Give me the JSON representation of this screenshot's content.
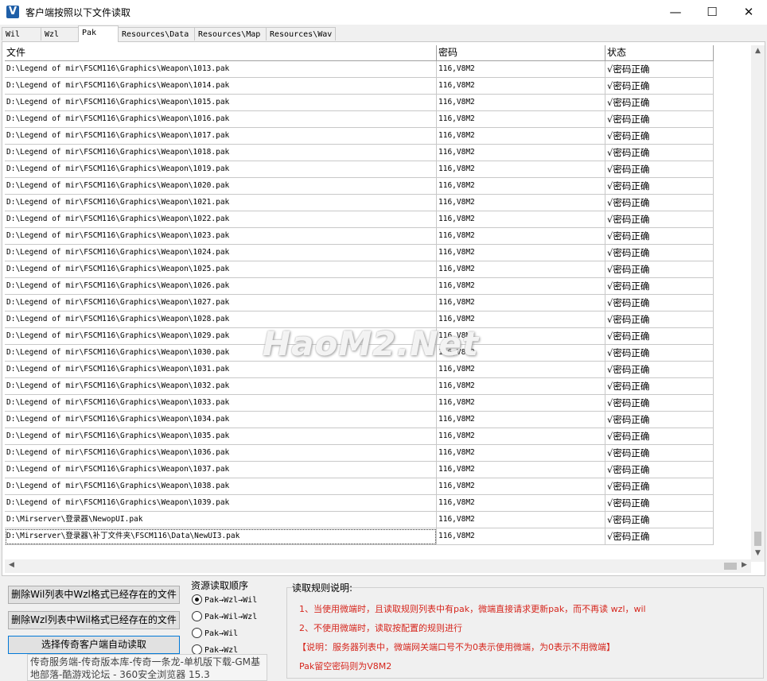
{
  "window": {
    "title": "客户端按照以下文件读取",
    "app_icon": "V",
    "controls": {
      "minimize": "—",
      "maximize": "☐",
      "close": "✕"
    }
  },
  "tabs": [
    {
      "label": "Wil"
    },
    {
      "label": "Wzl"
    },
    {
      "label": "Pak",
      "active": true
    },
    {
      "label": "Resources\\Data"
    },
    {
      "label": "Resources\\Map"
    },
    {
      "label": "Resources\\Wav"
    }
  ],
  "table": {
    "headers": {
      "file": "文件",
      "password": "密码",
      "status": "状态"
    },
    "rows": [
      {
        "file": "D:\\Legend of mir\\FSCM116\\Graphics\\Weapon\\1013.pak",
        "password": "116,V8M2",
        "status": "√密码正确"
      },
      {
        "file": "D:\\Legend of mir\\FSCM116\\Graphics\\Weapon\\1014.pak",
        "password": "116,V8M2",
        "status": "√密码正确"
      },
      {
        "file": "D:\\Legend of mir\\FSCM116\\Graphics\\Weapon\\1015.pak",
        "password": "116,V8M2",
        "status": "√密码正确"
      },
      {
        "file": "D:\\Legend of mir\\FSCM116\\Graphics\\Weapon\\1016.pak",
        "password": "116,V8M2",
        "status": "√密码正确"
      },
      {
        "file": "D:\\Legend of mir\\FSCM116\\Graphics\\Weapon\\1017.pak",
        "password": "116,V8M2",
        "status": "√密码正确"
      },
      {
        "file": "D:\\Legend of mir\\FSCM116\\Graphics\\Weapon\\1018.pak",
        "password": "116,V8M2",
        "status": "√密码正确"
      },
      {
        "file": "D:\\Legend of mir\\FSCM116\\Graphics\\Weapon\\1019.pak",
        "password": "116,V8M2",
        "status": "√密码正确"
      },
      {
        "file": "D:\\Legend of mir\\FSCM116\\Graphics\\Weapon\\1020.pak",
        "password": "116,V8M2",
        "status": "√密码正确"
      },
      {
        "file": "D:\\Legend of mir\\FSCM116\\Graphics\\Weapon\\1021.pak",
        "password": "116,V8M2",
        "status": "√密码正确"
      },
      {
        "file": "D:\\Legend of mir\\FSCM116\\Graphics\\Weapon\\1022.pak",
        "password": "116,V8M2",
        "status": "√密码正确"
      },
      {
        "file": "D:\\Legend of mir\\FSCM116\\Graphics\\Weapon\\1023.pak",
        "password": "116,V8M2",
        "status": "√密码正确"
      },
      {
        "file": "D:\\Legend of mir\\FSCM116\\Graphics\\Weapon\\1024.pak",
        "password": "116,V8M2",
        "status": "√密码正确"
      },
      {
        "file": "D:\\Legend of mir\\FSCM116\\Graphics\\Weapon\\1025.pak",
        "password": "116,V8M2",
        "status": "√密码正确"
      },
      {
        "file": "D:\\Legend of mir\\FSCM116\\Graphics\\Weapon\\1026.pak",
        "password": "116,V8M2",
        "status": "√密码正确"
      },
      {
        "file": "D:\\Legend of mir\\FSCM116\\Graphics\\Weapon\\1027.pak",
        "password": "116,V8M2",
        "status": "√密码正确"
      },
      {
        "file": "D:\\Legend of mir\\FSCM116\\Graphics\\Weapon\\1028.pak",
        "password": "116,V8M2",
        "status": "√密码正确"
      },
      {
        "file": "D:\\Legend of mir\\FSCM116\\Graphics\\Weapon\\1029.pak",
        "password": "116,V8M2",
        "status": "√密码正确"
      },
      {
        "file": "D:\\Legend of mir\\FSCM116\\Graphics\\Weapon\\1030.pak",
        "password": "116,V8M2",
        "status": "√密码正确"
      },
      {
        "file": "D:\\Legend of mir\\FSCM116\\Graphics\\Weapon\\1031.pak",
        "password": "116,V8M2",
        "status": "√密码正确"
      },
      {
        "file": "D:\\Legend of mir\\FSCM116\\Graphics\\Weapon\\1032.pak",
        "password": "116,V8M2",
        "status": "√密码正确"
      },
      {
        "file": "D:\\Legend of mir\\FSCM116\\Graphics\\Weapon\\1033.pak",
        "password": "116,V8M2",
        "status": "√密码正确"
      },
      {
        "file": "D:\\Legend of mir\\FSCM116\\Graphics\\Weapon\\1034.pak",
        "password": "116,V8M2",
        "status": "√密码正确"
      },
      {
        "file": "D:\\Legend of mir\\FSCM116\\Graphics\\Weapon\\1035.pak",
        "password": "116,V8M2",
        "status": "√密码正确"
      },
      {
        "file": "D:\\Legend of mir\\FSCM116\\Graphics\\Weapon\\1036.pak",
        "password": "116,V8M2",
        "status": "√密码正确"
      },
      {
        "file": "D:\\Legend of mir\\FSCM116\\Graphics\\Weapon\\1037.pak",
        "password": "116,V8M2",
        "status": "√密码正确"
      },
      {
        "file": "D:\\Legend of mir\\FSCM116\\Graphics\\Weapon\\1038.pak",
        "password": "116,V8M2",
        "status": "√密码正确"
      },
      {
        "file": "D:\\Legend of mir\\FSCM116\\Graphics\\Weapon\\1039.pak",
        "password": "116,V8M2",
        "status": "√密码正确"
      },
      {
        "file": "D:\\Mirserver\\登录器\\NewopUI.pak",
        "password": "116,V8M2",
        "status": "√密码正确"
      },
      {
        "file": "D:\\Mirserver\\登录器\\补丁文件夹\\FSCM116\\Data\\NewUI3.pak",
        "password": "116,V8M2",
        "status": "√密码正确",
        "selected": true
      }
    ]
  },
  "buttons": {
    "delete_wil": "删除Wil列表中Wzl格式已经存在的文件",
    "delete_wzl": "删除Wzl列表中Wil格式已经存在的文件",
    "auto_read": "选择传奇客户端自动读取"
  },
  "read_order": {
    "title": "资源读取顺序",
    "options": [
      {
        "label": "Pak→Wzl→Wil",
        "checked": true
      },
      {
        "label": "Pak→Wil→Wzl",
        "checked": false
      },
      {
        "label": "Pak→Wil",
        "checked": false
      },
      {
        "label": "Pak→Wzl",
        "checked": false
      }
    ]
  },
  "rules": {
    "title": "读取规则说明:",
    "lines": [
      "1、当使用微端时，且读取规则列表中有pak，微端直接请求更新pak，而不再读 wzl，wil",
      "2、不使用微端时，读取按配置的规则进行",
      "【说明：服务器列表中，微端网关端口号不为0表示使用微端，为0表示不用微端】",
      "Pak留空密码则为V8M2"
    ]
  },
  "overlay": {
    "line1": "传奇服务端-传奇版本库-传奇一条龙-单机版下载-GM基",
    "line2": "地部落-酷游戏论坛 - 360安全浏览器 15.3"
  },
  "watermark": "HaoM2.Net",
  "colors": {
    "rule_text": "#d6261d",
    "primary_border": "#0078d7",
    "app_icon": "#1f5fa8"
  }
}
